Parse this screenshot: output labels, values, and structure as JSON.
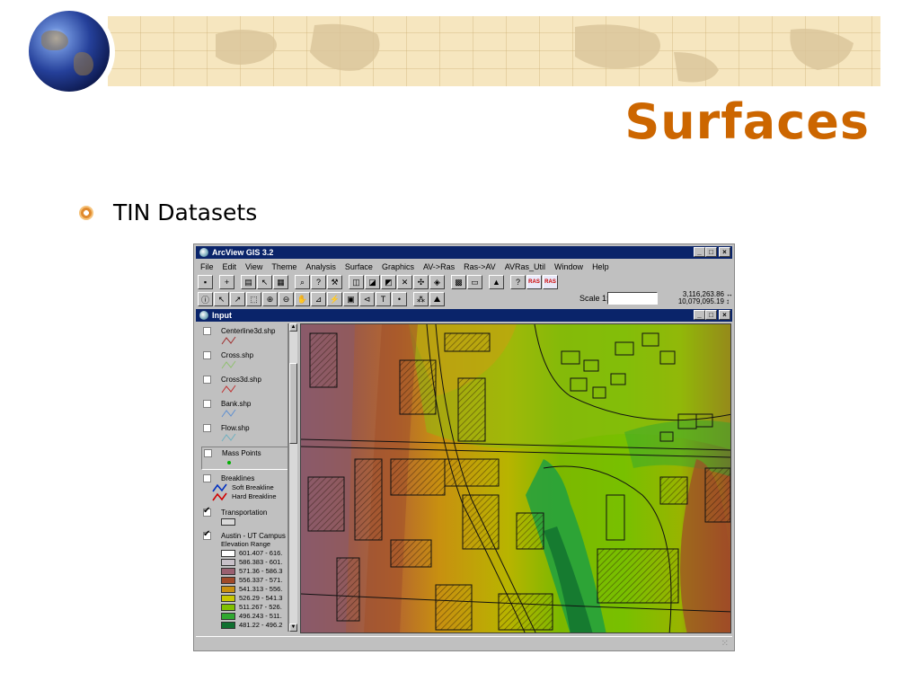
{
  "slide": {
    "title": "Surfaces",
    "bullet": "TIN Datasets"
  },
  "app": {
    "title": "ArcView GIS 3.2",
    "window_buttons": [
      "_",
      "□",
      "×"
    ],
    "menu": [
      "File",
      "Edit",
      "View",
      "Theme",
      "Analysis",
      "Surface",
      "Graphics",
      "AV->Ras",
      "Ras->AV",
      "AVRas_Util",
      "Window",
      "Help"
    ],
    "scale_label": "Scale 1:",
    "scale_value": "",
    "coord_x": "3,116,263.86",
    "coord_y": "10,079,095.19",
    "coord_x_arrow": "↔",
    "coord_y_arrow": "↕"
  },
  "view": {
    "title": "Input",
    "layers": [
      {
        "name": "Centerline3d.shp",
        "checked": false,
        "color": "#a03030"
      },
      {
        "name": "Cross.shp",
        "checked": false,
        "color": "#90c070"
      },
      {
        "name": "Cross3d.shp",
        "checked": false,
        "color": "#c03030"
      },
      {
        "name": "Bank.shp",
        "checked": false,
        "color": "#6090d0"
      },
      {
        "name": "Flow.shp",
        "checked": false,
        "color": "#70b0c0"
      },
      {
        "name": "Mass Points",
        "checked": false,
        "color": "#00b000"
      },
      {
        "name": "Breaklines",
        "checked": false
      },
      {
        "name": "Transportation",
        "checked": true
      },
      {
        "name": "Austin - UT Campus",
        "checked": true
      }
    ],
    "breaklines": {
      "soft": "Soft Breakline",
      "hard": "Hard Breakline",
      "soft_color": "#0030c0",
      "hard_color": "#d00000"
    },
    "elevation": {
      "label": "Elevation Range",
      "ranges": [
        {
          "label": "601.407 - 616.",
          "color": "#ffffff"
        },
        {
          "label": "586.383 - 601.",
          "color": "#c8c0c8"
        },
        {
          "label": "571.36 - 586.3",
          "color": "#9a6070"
        },
        {
          "label": "556.337 - 571.",
          "color": "#a04a28"
        },
        {
          "label": "541.313 - 556.",
          "color": "#c89010"
        },
        {
          "label": "526.29 - 541.3",
          "color": "#c8c800"
        },
        {
          "label": "511.267 - 526.",
          "color": "#80c000"
        },
        {
          "label": "496.243 - 511.",
          "color": "#30a830"
        },
        {
          "label": "481.22 - 496.2",
          "color": "#107030"
        }
      ]
    }
  },
  "colors": {
    "title_orange": "#cc6600",
    "titlebar_blue": "#0a246a"
  }
}
